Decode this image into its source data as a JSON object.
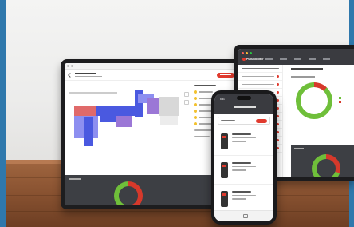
{
  "scene": {
    "description_colors": {
      "wall": "#efefee",
      "table": "#8b5432",
      "frame": "#2f78ac",
      "accent_red": "#e03a2e",
      "gauge_green": "#6fbf3a",
      "gauge_red": "#d6392b"
    }
  },
  "laptop": {
    "brand": "PuduMonitor"
  },
  "phone": {
    "time": "9:41"
  }
}
